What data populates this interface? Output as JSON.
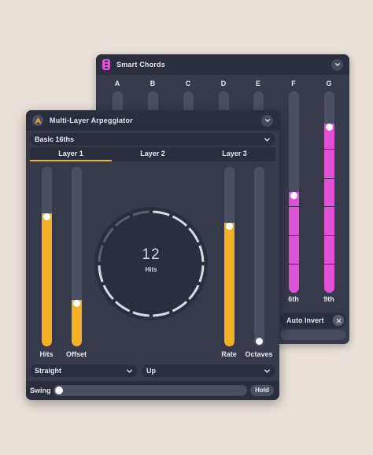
{
  "smart_chords": {
    "title": "Smart Chords",
    "columns": [
      {
        "letter": "A",
        "label": "",
        "level": 0
      },
      {
        "letter": "B",
        "label": "",
        "level": 0
      },
      {
        "letter": "C",
        "label": "",
        "level": 0
      },
      {
        "letter": "D",
        "label": "",
        "level": 0
      },
      {
        "letter": "E",
        "label": "",
        "level": 0
      },
      {
        "letter": "F",
        "label": "6th",
        "level": 0.5
      },
      {
        "letter": "G",
        "label": "9th",
        "level": 0.84
      }
    ],
    "auto_invert_label": "Auto Invert"
  },
  "arpeggiator": {
    "title": "Multi-Layer Arpeggiator",
    "preset": "Basic 16ths",
    "tabs": [
      {
        "label": "Layer 1",
        "active": true
      },
      {
        "label": "Layer 2",
        "active": false
      },
      {
        "label": "Layer 3",
        "active": false
      }
    ],
    "sliders": {
      "hits": {
        "label": "Hits",
        "level": 0.74
      },
      "offset": {
        "label": "Offset",
        "level": 0.26
      },
      "rate": {
        "label": "Rate",
        "level": 0.69
      },
      "octaves": {
        "label": "Octaves",
        "level": 0.0
      }
    },
    "dial": {
      "value": "12",
      "label": "Hits",
      "steps": 16,
      "active_steps": 12
    },
    "timing_mode": "Straight",
    "direction": "Up",
    "swing_label": "Swing",
    "swing_level": 0.0,
    "hold_label": "Hold"
  },
  "colors": {
    "accent_orange": "#f4b223",
    "accent_pink": "#e24fd8",
    "panel": "#363a4b",
    "panel_dark": "#2b2e3c",
    "background": "#e8e1d9"
  }
}
